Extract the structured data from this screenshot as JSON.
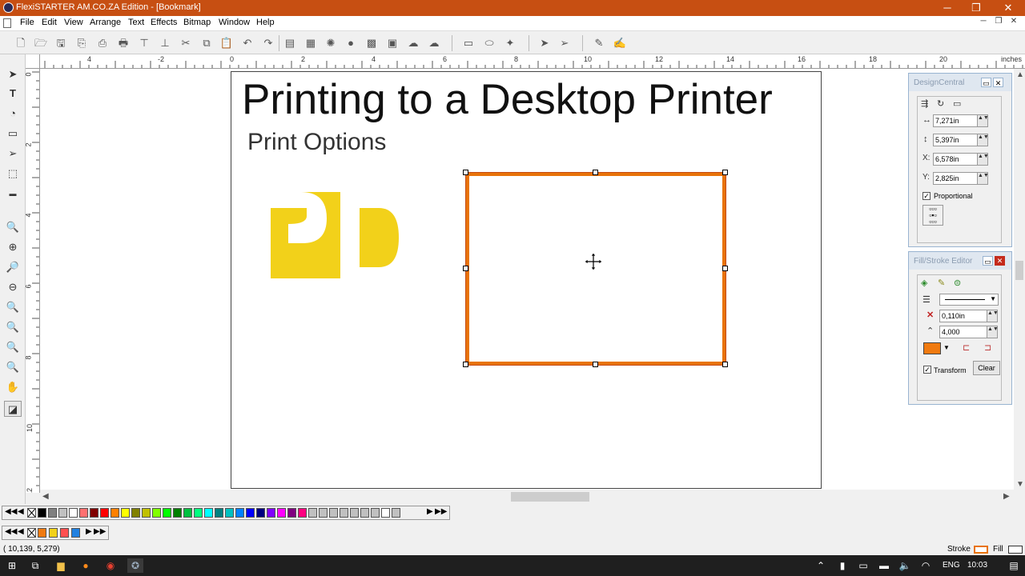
{
  "window": {
    "title": "FlexiSTARTER AM.CO.ZA Edition - [Bookmark]",
    "minimize": "─",
    "restore": "❐",
    "close": "✕"
  },
  "menu": {
    "items": [
      "File",
      "Edit",
      "View",
      "Arrange",
      "Text",
      "Effects",
      "Bitmap",
      "Window",
      "Help"
    ],
    "mdi_minimize": "─",
    "mdi_restore": "❐",
    "mdi_close": "✕"
  },
  "ruler": {
    "unit": "inches",
    "h_labels": [
      "4",
      "-2",
      "0",
      "2",
      "4",
      "6",
      "8",
      "10",
      "12",
      "14",
      "16",
      "18",
      "20"
    ],
    "v_labels": [
      "0",
      "2",
      "4",
      "6",
      "8",
      "10",
      "12"
    ]
  },
  "document": {
    "heading": "Printing to a Desktop Printer",
    "subheading": "Print Options",
    "logo_colors": {
      "yellow": "#f2d11a"
    },
    "selection_stroke": "#e8730a"
  },
  "design_central": {
    "title": "DesignCentral",
    "width_value": "7,271in",
    "height_value": "5,397in",
    "x_label": "X:",
    "x_value": "6,578in",
    "y_label": "Y:",
    "y_value": "2,825in",
    "proportional_label": "Proportional",
    "proportional_checked": true
  },
  "fill_stroke_editor": {
    "title": "Fill/Stroke Editor",
    "stroke_width_value": "0,110in",
    "miter_value": "4,000",
    "stroke_color": "#f07a10",
    "transform_label": "Transform",
    "transform_checked": true,
    "clear_label": "Clear"
  },
  "palette": {
    "row1_colors": [
      "#000000",
      "#808080",
      "#c0c0c0",
      "#ffffff",
      "#ff7070",
      "#800000",
      "#ff0000",
      "#ff8000",
      "#ffff00",
      "#808000",
      "#c0c000",
      "#80ff00",
      "#00ff00",
      "#008000",
      "#00c040",
      "#00ff80",
      "#00ffff",
      "#008080",
      "#00c0c0",
      "#0080ff",
      "#0000ff",
      "#000080",
      "#8000ff",
      "#ff00ff",
      "#800080",
      "#ff0080",
      "#c0c0c0",
      "#c0c0c0",
      "#c0c0c0",
      "#c0c0c0",
      "#c0c0c0",
      "#c0c0c0",
      "#c0c0c0",
      "#ffffff",
      "#c0c0c0"
    ],
    "row2_colors": [
      "#f07a10",
      "#f2d11a",
      "#ff5050",
      "#2080e0"
    ]
  },
  "status": {
    "coordinates": "( 10,139,     5,279)",
    "stroke_label": "Stroke",
    "fill_label": "Fill"
  },
  "taskbar": {
    "language": "ENG",
    "time": "10:03"
  }
}
